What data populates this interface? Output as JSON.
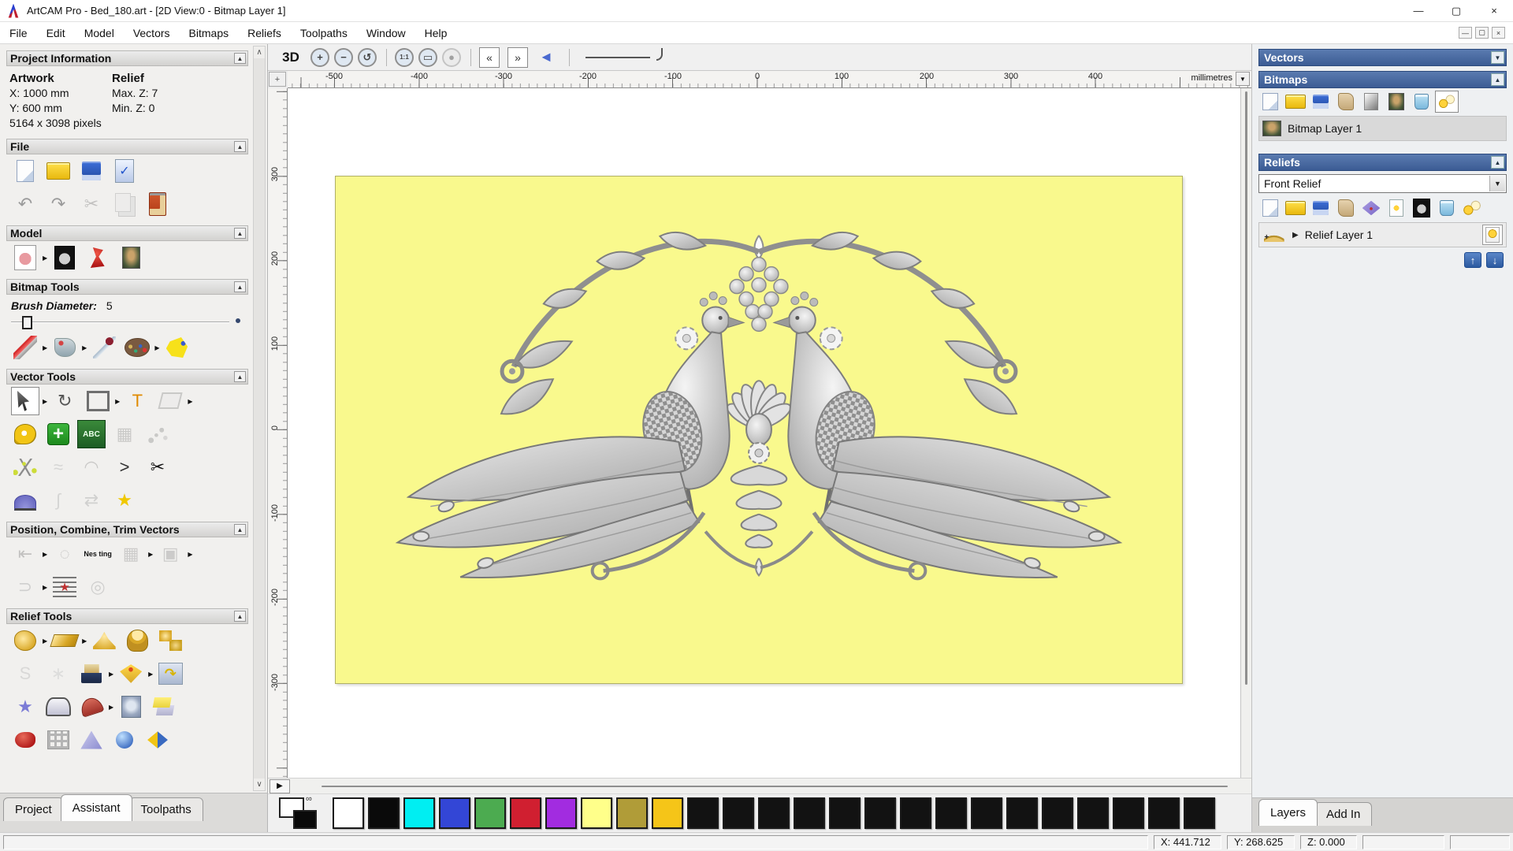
{
  "window": {
    "title": "ArtCAM Pro - Bed_180.art - [2D View:0 - Bitmap Layer 1]",
    "minimize": "—",
    "maximize": "▢",
    "close": "×"
  },
  "menu": {
    "items": [
      "File",
      "Edit",
      "Model",
      "Vectors",
      "Bitmaps",
      "Reliefs",
      "Toolpaths",
      "Window",
      "Help"
    ],
    "mdi_minimize": "—",
    "mdi_restore": "▢",
    "mdi_close": "×"
  },
  "assistant": {
    "project_info": {
      "title": "Project Information",
      "artwork_heading": "Artwork",
      "relief_heading": "Relief",
      "x": "X: 1000 mm",
      "y": "Y: 600 mm",
      "pixels": "5164 x 3098 pixels",
      "max_z": "Max. Z: 7",
      "min_z": "Min. Z: 0"
    },
    "sections": {
      "file": "File",
      "model": "Model",
      "bitmap_tools": "Bitmap Tools",
      "vector_tools": "Vector Tools",
      "position": "Position, Combine, Trim Vectors",
      "relief_tools": "Relief Tools"
    },
    "brush_label": "Brush Diameter:",
    "brush_value": "5",
    "tabs": [
      "Project",
      "Assistant",
      "Toolpaths"
    ],
    "scroll_up": "∧",
    "scroll_down": "∨",
    "collapse_glyph": "▲"
  },
  "view_toolbar": {
    "to3d": "3D"
  },
  "rulers": {
    "h": [
      "-500",
      "-400",
      "-300",
      "-200",
      "-100",
      "0",
      "100",
      "200",
      "300",
      "400"
    ],
    "v": [
      "300",
      "200",
      "100",
      "0",
      "-100",
      "-200",
      "-300"
    ],
    "units": "millimetres"
  },
  "layers_panel": {
    "vectors_title": "Vectors",
    "bitmaps_title": "Bitmaps",
    "bitmap_layer": "Bitmap Layer 1",
    "reliefs_title": "Reliefs",
    "relief_set": "Front Relief",
    "relief_layer": "Relief Layer 1",
    "expander": "▶",
    "tabs": [
      "Layers",
      "Add In"
    ],
    "up": "↑",
    "down": "↓",
    "collapse_down": "▼",
    "collapse_up": "▲"
  },
  "palette": {
    "link_glyph": "∞",
    "primary": "#ffffff",
    "secondary": "#0a0a0a",
    "swatches": [
      "#ffffff",
      "#0a0a0a",
      "#00eef2",
      "#3346d6",
      "#4cab50",
      "#d01f30",
      "#a22ce0",
      "#ffff8a",
      "#b09c38",
      "#f5c518",
      "#121212",
      "#121212",
      "#121212",
      "#121212",
      "#121212",
      "#121212",
      "#121212",
      "#121212",
      "#121212",
      "#121212",
      "#121212",
      "#121212",
      "#121212",
      "#121212",
      "#121212"
    ]
  },
  "status": {
    "x": "X: 441.712",
    "y": "Y: 268.625",
    "z": "Z: 0.000"
  },
  "icons": {
    "file_row1": [
      {
        "n": "new-model-icon",
        "k": "sh-page"
      },
      {
        "n": "open-model-icon",
        "k": "sh-folder"
      },
      {
        "n": "save-model-icon",
        "k": "sh-floppy"
      },
      {
        "n": "model-options-icon",
        "k": "sh-check"
      }
    ],
    "file_row2": [
      {
        "n": "undo-icon",
        "g": "↶",
        "c": "#9b9b9b"
      },
      {
        "n": "redo-icon",
        "g": "↷",
        "c": "#9b9b9b"
      },
      {
        "n": "cut-icon",
        "g": "✂",
        "c": "#8a8a8a",
        "dis": true
      },
      {
        "n": "copy-icon",
        "k": "sh-copy",
        "dis": true
      },
      {
        "n": "paste-icon",
        "k": "sh-clip"
      }
    ],
    "model_row": [
      {
        "n": "set-model-size-icon",
        "k": "sh-teddy",
        "fly": true
      },
      {
        "n": "greyscale-view-icon",
        "k": "sh-teddybw"
      },
      {
        "n": "lighting-icon",
        "k": "sh-lamp"
      },
      {
        "n": "clear-bitmap-icon",
        "k": "sh-mona"
      }
    ],
    "bitmap_row": [
      {
        "n": "paint-icon",
        "k": "sh-paint",
        "fly": true
      },
      {
        "n": "flood-fill-icon",
        "k": "sh-bucket",
        "fly": true
      },
      {
        "n": "colour-picker-icon",
        "k": "sh-dropper"
      },
      {
        "n": "palette-icon",
        "k": "sh-pal",
        "fly": true
      },
      {
        "n": "magic-wand-icon",
        "k": "sh-magic"
      }
    ],
    "vector_row1": [
      {
        "n": "select-vectors-icon",
        "k": "sh-cursor",
        "sel": true,
        "fly": true
      },
      {
        "n": "transform-vectors-icon",
        "g": "↻",
        "c": "#555555"
      },
      {
        "n": "create-rectangle-icon",
        "k": "sh-rect",
        "fly": true
      },
      {
        "n": "create-text-icon",
        "g": "T",
        "c": "#e08a00"
      },
      {
        "n": "envelope-distort-icon",
        "k": "sh-env",
        "dis": true,
        "fly": true
      }
    ],
    "vector_row2": [
      {
        "n": "measure-icon",
        "k": "sh-tape"
      },
      {
        "n": "node-editing-icon",
        "k": "sh-node"
      },
      {
        "n": "text-tools-icon",
        "k": "sh-abc",
        "g": "ABC"
      },
      {
        "n": "mesh-creator-icon",
        "g": "▦",
        "c": "#9a9a9a",
        "dis": true
      },
      {
        "n": "paste-along-curve-icon",
        "k": "sh-dots",
        "dis": true
      }
    ],
    "vector_row3": [
      {
        "n": "create-polyline-icon",
        "k": "sh-poly"
      },
      {
        "n": "sculpt-vectors-icon",
        "g": "≈",
        "c": "#b5b5b5",
        "dis": true
      },
      {
        "n": "create-arc-icon",
        "g": "◠",
        "c": "#999999",
        "dis": true
      },
      {
        "n": "vee-carving-icon",
        "g": ">",
        "c": "#333333"
      },
      {
        "n": "trim-vectors-icon",
        "g": "✂",
        "c": "#111111"
      }
    ],
    "vector_row4": [
      {
        "n": "dome-tool-icon",
        "k": "sh-dome"
      },
      {
        "n": "fit-arcs-icon",
        "g": "∫",
        "c": "#b5b5b5",
        "dis": true
      },
      {
        "n": "mirror-vectors-icon",
        "g": "⇄",
        "c": "#aaaaaa",
        "dis": true
      },
      {
        "n": "create-star-icon",
        "g": "★",
        "c": "#f0c800"
      }
    ],
    "position_row1": [
      {
        "n": "align-vectors-icon",
        "g": "⇤",
        "c": "#8a8a8a",
        "dis": true,
        "fly": true
      },
      {
        "n": "text-on-curve-icon",
        "g": "◌",
        "c": "#8a8a8a",
        "dis": true
      },
      {
        "n": "nesting-icon",
        "k": "sh-nes",
        "g": "Nes ting"
      },
      {
        "n": "block-copy-icon",
        "g": "▦",
        "c": "#a0a0a0",
        "dis": true,
        "fly": true
      },
      {
        "n": "weld-vectors-icon",
        "g": "▣",
        "c": "#a0a0a0",
        "dis": true,
        "fly": true
      }
    ],
    "position_row2": [
      {
        "n": "join-vectors-icon",
        "g": "⊃",
        "c": "#a8a8a8",
        "dis": true,
        "fly": true
      },
      {
        "n": "vector-texture-icon",
        "k": "sh-wave"
      },
      {
        "n": "spiral-icon",
        "g": "◎",
        "c": "#a8a8a8",
        "dis": true
      }
    ],
    "relief_row1": [
      {
        "n": "calculate-relief-icon",
        "k": "sh-goldteddy",
        "fly": true
      },
      {
        "n": "shape-editor-icon",
        "k": "sh-goldbar",
        "fly": true
      },
      {
        "n": "add-relief-icon",
        "k": "sh-goldmound"
      },
      {
        "n": "subtract-relief-icon",
        "k": "sh-goldmush"
      },
      {
        "n": "merge-relief-icon",
        "k": "sh-goldpair"
      }
    ],
    "relief_row2": [
      {
        "n": "smooth-relief-icon",
        "g": "S",
        "c": "#bdbdbd",
        "dis": true
      },
      {
        "n": "weave-wizard-icon",
        "g": "∗",
        "c": "#c7c7c7",
        "dis": true
      },
      {
        "n": "relief-from-image-icon",
        "k": "sh-book",
        "fly": true
      },
      {
        "n": "offset-relief-icon",
        "k": "sh-golddiamond",
        "fly": true
      },
      {
        "n": "flip-relief-icon",
        "k": "sh-flip"
      }
    ],
    "relief_row3": [
      {
        "n": "texture-relief-icon",
        "g": "★",
        "c": "#7b7bd6"
      },
      {
        "n": "envelope-relief-icon",
        "k": "sh-envrelief"
      },
      {
        "n": "bend-relief-icon",
        "k": "sh-bend",
        "fly": true
      },
      {
        "n": "emboss-relief-icon",
        "k": "sh-emboss"
      },
      {
        "n": "offset-layers-icon",
        "k": "sh-sheets"
      }
    ],
    "relief_row4": [
      {
        "n": "sculpting-icon",
        "k": "sh-red"
      },
      {
        "n": "basket-weave-icon",
        "k": "sh-basket"
      },
      {
        "n": "pyramid-relief-icon",
        "k": "sh-pyr"
      },
      {
        "n": "sphere-texture-icon",
        "k": "sh-sphere"
      },
      {
        "n": "two-colour-relief-icon",
        "k": "sh-duo"
      }
    ],
    "view_row": [
      {
        "n": "switch-to-3d-button",
        "k": "sh-3d",
        "g": "3D"
      },
      {
        "n": "zoom-in-icon",
        "k": "sh-mag",
        "g": "+"
      },
      {
        "n": "zoom-out-icon",
        "k": "sh-mag",
        "g": "−"
      },
      {
        "n": "zoom-previous-icon",
        "k": "sh-mag",
        "g": "↺"
      },
      {
        "n": "sep"
      },
      {
        "n": "zoom-scale-icon",
        "k": "sh-mag small",
        "g": "1:1"
      },
      {
        "n": "zoom-objects-icon",
        "k": "sh-mag",
        "g": "▭"
      },
      {
        "n": "zoom-drag-icon",
        "k": "sh-mag",
        "g": "●",
        "dis": true
      },
      {
        "n": "sep"
      },
      {
        "n": "copy-view-left-icon",
        "k": "sh-xfer",
        "g": "«",
        "sel": true
      },
      {
        "n": "copy-view-right-icon",
        "k": "sh-xfer",
        "g": "»",
        "sel": true
      },
      {
        "n": "preview-relief-icon",
        "k": "sh-prev",
        "g": "◄"
      },
      {
        "n": "sep"
      }
    ],
    "bitmaps_toolbar": [
      {
        "n": "bitmap-new-icon",
        "k": "sh-page"
      },
      {
        "n": "bitmap-open-icon",
        "k": "sh-folder"
      },
      {
        "n": "bitmap-save-icon",
        "k": "sh-floppy"
      },
      {
        "n": "bitmap-merge-icon",
        "k": "sh-scroll"
      },
      {
        "n": "bitmap-greyscale-icon",
        "k": "sh-grad"
      },
      {
        "n": "bitmap-layer-copy-icon",
        "k": "sh-mona"
      },
      {
        "n": "bitmap-delete-icon",
        "k": "sh-trash"
      },
      {
        "n": "bitmap-visibility-icon",
        "k": "sh-bulbs",
        "sel": true
      }
    ],
    "reliefs_toolbar": [
      {
        "n": "relief-new-icon",
        "k": "sh-page"
      },
      {
        "n": "relief-open-icon",
        "k": "sh-folder"
      },
      {
        "n": "relief-save-icon",
        "k": "sh-floppy"
      },
      {
        "n": "relief-merge-icon",
        "k": "sh-scroll"
      },
      {
        "n": "relief-stack-icon",
        "k": "sh-stack"
      },
      {
        "n": "relief-preview-icon",
        "k": "sh-bulbpage"
      },
      {
        "n": "relief-greyscale-icon",
        "k": "sh-teddybw"
      },
      {
        "n": "relief-delete-icon",
        "k": "sh-trash"
      },
      {
        "n": "relief-visibility-icon",
        "k": "sh-bulbs"
      }
    ]
  }
}
